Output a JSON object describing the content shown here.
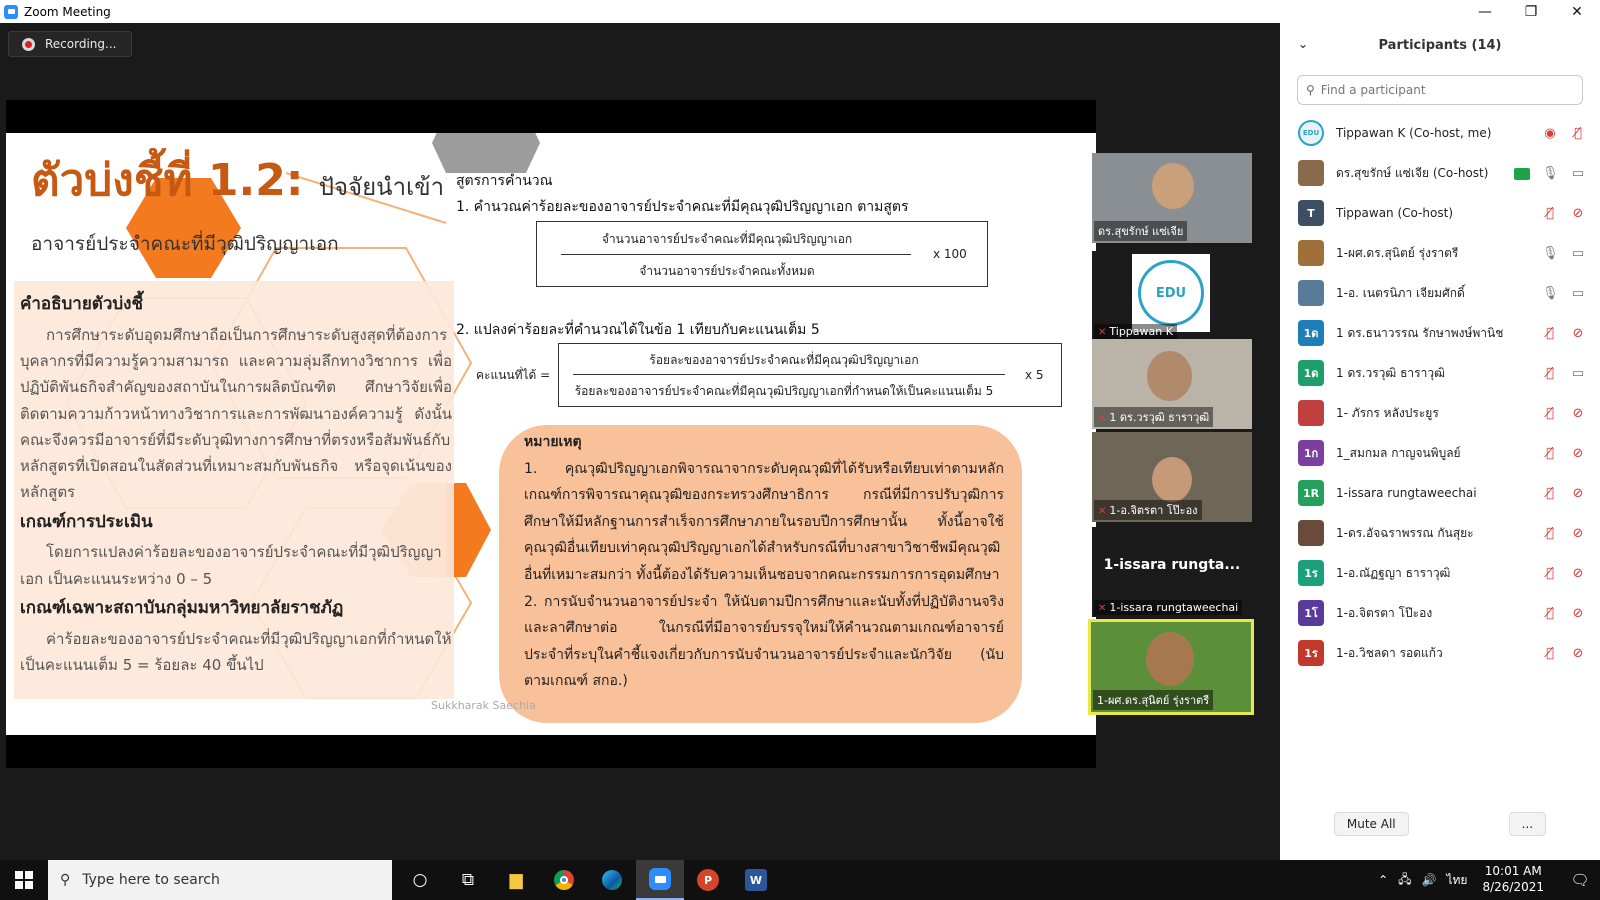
{
  "window": {
    "title": "Zoom Meeting",
    "minimize": "—",
    "maximize": "❐",
    "close": "✕"
  },
  "recording": {
    "label": "Recording..."
  },
  "slide": {
    "title_main": "ตัวบ่งชี้ที่ 1.2:",
    "title_sub": "ปัจจัยนำเข้า",
    "title_line2": "อาจารย์ประจำคณะที่มีวุฒิปริญญาเอก",
    "desc_heading": "คำอธิบายตัวบ่งชี้",
    "desc_body": "การศึกษาระดับอุดมศึกษาถือเป็นการศึกษาระดับสูงสุดที่ต้องการบุคลากรที่มีความรู้ความสามารถ และความลุ่มลึกทางวิชาการ เพื่อปฏิบัติพันธกิจสำคัญของสถาบันในการผลิตบัณฑิต ศึกษาวิจัยเพื่อติดตามความก้าวหน้าทางวิชาการและการพัฒนาองค์ความรู้ ดังนั้นคณะจึงควรมีอาจารย์ที่มีระดับวุฒิทางการศึกษาที่ตรงหรือสัมพันธ์กับหลักสูตรที่เปิดสอนในสัดส่วนที่เหมาะสมกับพันธกิจ หรือจุดเน้นของหลักสูตร",
    "eval_heading": "เกณฑ์การประเมิน",
    "eval_body": "โดยการแปลงค่าร้อยละของอาจารย์ประจำคณะที่มีวุฒิปริญญาเอก เป็นคะแนนระหว่าง 0 – 5",
    "rajabhat_heading": "เกณฑ์เฉพาะสถาบันกลุ่มมหาวิทยาลัยราชภัฏ",
    "rajabhat_body": "ค่าร้อยละของอาจารย์ประจำคณะที่มีวุฒิปริญญาเอกที่กำหนดให้เป็นคะแนนเต็ม 5 = ร้อยละ 40 ขึ้นไป",
    "formula_heading": "สูตรการคำนวณ",
    "formula1_label": "1. คำนวณค่าร้อยละของอาจารย์ประจำคณะที่มีคุณวุฒิปริญญาเอก ตามสูตร",
    "formula1_num": "จำนวนอาจารย์ประจำคณะที่มีคุณวุฒิปริญญาเอก",
    "formula1_den": "จำนวนอาจารย์ประจำคณะทั้งหมด",
    "formula1_mult": "x 100",
    "formula2_label": "2. แปลงค่าร้อยละที่คำนวณได้ในข้อ 1 เทียบกับคะแนนเต็ม 5",
    "score_label": "คะแนนที่ได้ =",
    "formula2_num": "ร้อยละของอาจารย์ประจำคณะที่มีคุณวุฒิปริญญาเอก",
    "formula2_den": "ร้อยละของอาจารย์ประจำคณะที่มีคุณวุฒิปริญญาเอกที่กำหนดให้เป็นคะแนนเต็ม 5",
    "formula2_mult": "x 5",
    "note_heading": "หมายเหตุ",
    "note1": "1. คุณวุฒิปริญญาเอกพิจารณาจากระดับคุณวุฒิที่ได้รับหรือเทียบเท่าตามหลักเกณฑ์การพิจารณาคุณวุฒิของกระทรวงศึกษาธิการ กรณีที่มีการปรับวุฒิการศึกษาให้มีหลักฐานการสำเร็จการศึกษาภายในรอบปีการศึกษานั้น ทั้งนี้อาจใช้คุณวุฒิอื่นเทียบเท่าคุณวุฒิปริญญาเอกได้สำหรับกรณีที่บางสาขาวิชาชีพมีคุณวุฒิอื่นที่เหมาะสมกว่า ทั้งนี้ต้องได้รับความเห็นชอบจากคณะกรรมการการอุดมศึกษา",
    "note2": "2. การนับจำนวนอาจารย์ประจำ ให้นับตามปีการศึกษาและนับทั้งที่ปฏิบัติงานจริงและลาศึกษาต่อ ในกรณีที่มีอาจารย์บรรจุใหม่ให้คำนวณตามเกณฑ์อาจารย์ประจำที่ระบุในคำชี้แจงเกี่ยวกับการนับจำนวนอาจารย์ประจำและนักวิจัย (นับตามเกณฑ์ สกอ.)",
    "watermark": "Sukkharak Saechia"
  },
  "thumbnails": [
    {
      "name": "ดร.สุขรักษ์ แซ่เจีย",
      "muted": false,
      "bg": "#8a8f93"
    },
    {
      "name": "Tippawan K",
      "muted": true,
      "bg": "#1b1b1b"
    },
    {
      "name": "1 ดร.วรวุฒิ ธาราวุฒิ",
      "muted": true,
      "bg": "#b9b3a8"
    },
    {
      "name": "1-อ.จิตรตา โป๊ะอง",
      "muted": true,
      "bg": "#6e6657"
    },
    {
      "name": "1-issara rungtaweechai",
      "muted": true,
      "bg": "#1b1b1b",
      "big_label": "1-issara rungta..."
    },
    {
      "name": "1-ผศ.ดร.สุนิตย์ รุ่งราตรี",
      "muted": false,
      "bg": "#5c8f3a"
    }
  ],
  "panel": {
    "title": "Participants (14)",
    "search_placeholder": "Find a participant",
    "mute_all": "Mute All",
    "more": "...",
    "participants": [
      {
        "name": "Tippawan K (Co-host, me)",
        "avatar": "EDU",
        "color": "#e8f2f5",
        "mic": "muted",
        "cam": "rec"
      },
      {
        "name": "ดร.สุขรักษ์ แซ่เจีย (Co-host)",
        "avatar": "",
        "color": "#8a6a4a",
        "mic": "on",
        "cam": "on",
        "sharing": true
      },
      {
        "name": "Tippawan (Co-host)",
        "avatar": "T",
        "color": "#3c4f63",
        "mic": "muted",
        "cam": "off"
      },
      {
        "name": "1-ผศ.ดร.สุนิตย์ รุ่งราตรี",
        "avatar": "",
        "color": "#a0703a",
        "mic": "on",
        "cam": "on"
      },
      {
        "name": "1-อ. เนตรนิภา เจียมศักดิ์",
        "avatar": "",
        "color": "#5a7a9a",
        "mic": "on",
        "cam": "on"
      },
      {
        "name": "1 ดร.ธนาวรรณ รักษาพงษ์พานิช",
        "avatar": "1ด",
        "color": "#1e7fb8",
        "mic": "muted",
        "cam": "off"
      },
      {
        "name": "1 ดร.วรวุฒิ ธาราวุฒิ",
        "avatar": "1ด",
        "color": "#1e9e6a",
        "mic": "muted",
        "cam": "on"
      },
      {
        "name": "1- ภัรกร หลังประยูร",
        "avatar": "",
        "color": "#c04040",
        "mic": "muted",
        "cam": "off"
      },
      {
        "name": "1_สมกมล กาญจนพิบูลย์",
        "avatar": "1ก",
        "color": "#7b3fa0",
        "mic": "muted",
        "cam": "off"
      },
      {
        "name": "1-issara rungtaweechai",
        "avatar": "1R",
        "color": "#25a05a",
        "mic": "muted",
        "cam": "off"
      },
      {
        "name": "1-ดร.อัจฉราพรรณ กันสุยะ",
        "avatar": "",
        "color": "#6a4a3a",
        "mic": "muted",
        "cam": "off"
      },
      {
        "name": "1-อ.ณัฏฐญา ธาราวุฒิ",
        "avatar": "1ร",
        "color": "#1aa07a",
        "mic": "muted",
        "cam": "off"
      },
      {
        "name": "1-อ.จิตรตา โป๊ะอง",
        "avatar": "1โ",
        "color": "#5a3a9a",
        "mic": "muted",
        "cam": "off"
      },
      {
        "name": "1-อ.วิชลดา รอดแก้ว",
        "avatar": "1ร",
        "color": "#c0392b",
        "mic": "muted",
        "cam": "off"
      }
    ]
  },
  "taskbar": {
    "search_placeholder": "Type here to search",
    "language": "ไทย",
    "time": "10:01 AM",
    "date": "8/26/2021"
  }
}
